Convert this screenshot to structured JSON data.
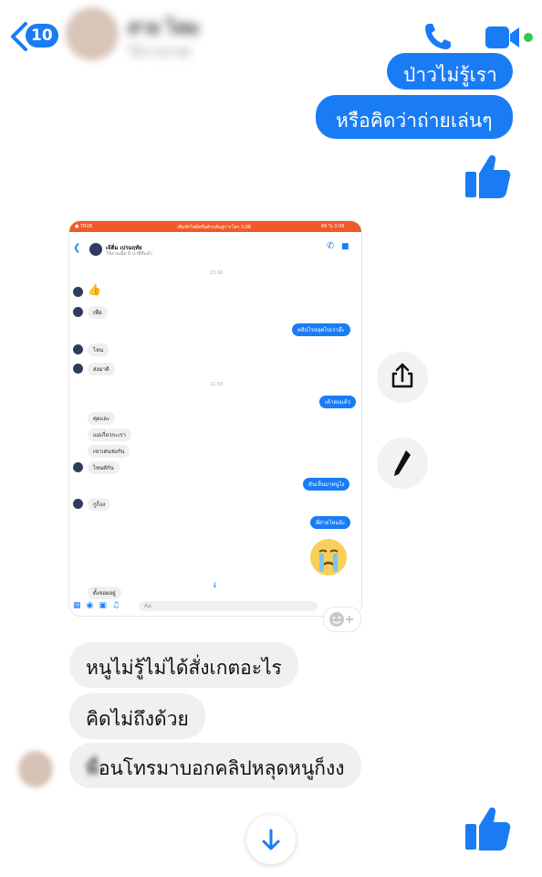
{
  "header": {
    "back_count": "10",
    "contact_name": "สาย ไหม",
    "contact_status": "ใช้งานล่าสุด",
    "accent_color": "#1a7cf5"
  },
  "messages_top": {
    "partial_bubble": "ป่าวไม่รู้เรา",
    "bubble_1": "หรือคิดว่าถ่ายเล่นๆ"
  },
  "shared_screenshot": {
    "status_bar": {
      "left": "● TRUE",
      "center": "เพิ่มทักไฟล์หรือตัวกลับสู่การโทร 3:08",
      "right": "89 % 3:08"
    },
    "contact_name": "เจ้ติ่ม เปรมฤทัย",
    "contact_status": "ใช้งานเมื่อ 6 นาทีที่แล้ว",
    "time_1": "13:36",
    "time_2": "11:33",
    "messages": [
      {
        "dir": "in",
        "text": "เพื่อ"
      },
      {
        "dir": "out",
        "text": "คลิปไรหลุดไปเราอ๊ะ"
      },
      {
        "dir": "in",
        "text": "ไหน"
      },
      {
        "dir": "in",
        "text": "ส่งมาดิ"
      },
      {
        "dir": "out",
        "text": "เค้าลบแล้ว"
      },
      {
        "dir": "in",
        "text": "คุยและ"
      },
      {
        "dir": "in",
        "text": "แม่เกี่ยวกะเรา"
      },
      {
        "dir": "in",
        "text": "เขาเค่นช่งกัน"
      },
      {
        "dir": "in",
        "text": "ไหนดักัน"
      },
      {
        "dir": "out",
        "text": "ดันเห็นมาหนูไง"
      },
      {
        "dir": "in",
        "text": "กูก็งง"
      },
      {
        "dir": "out",
        "text": "พี่ถ่ายไหมอ้ะ"
      },
      {
        "dir": "in",
        "text": "ดั้งจอยอยู่"
      }
    ],
    "composer_placeholder": "Aa"
  },
  "messages_bottom": {
    "in_1": "หนูไม่รู้ไม่ได้สั่งเกตอะไร",
    "in_2": "คิดไม่ถึงด้วย",
    "in_3_prefix": "พื",
    "in_3": "่อนโทรมาบอกคลิปหลุดหนูก็งง"
  },
  "icons": {
    "back": "chevron-left-icon",
    "phone": "phone-icon",
    "video": "video-camera-icon",
    "like": "thumbs-up-icon",
    "share": "share-icon",
    "edit": "pencil-icon",
    "add_reaction": "add-reaction-icon",
    "scroll_down": "arrow-down-icon"
  }
}
